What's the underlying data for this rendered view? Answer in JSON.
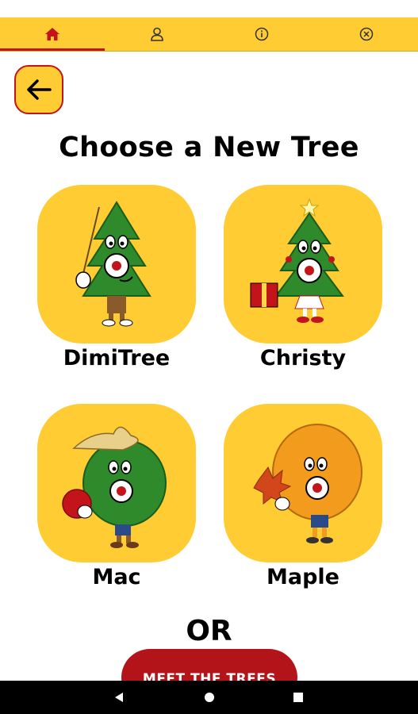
{
  "tabs": [
    {
      "icon": "home-icon",
      "active": true
    },
    {
      "icon": "person-icon",
      "active": false
    },
    {
      "icon": "info-icon",
      "active": false
    },
    {
      "icon": "close-circle-icon",
      "active": false
    }
  ],
  "back_button": {
    "icon": "arrow-left-icon"
  },
  "title": "Choose a New Tree",
  "trees": [
    {
      "name": "DimiTree"
    },
    {
      "name": "Christy"
    },
    {
      "name": "Mac"
    },
    {
      "name": "Maple"
    }
  ],
  "or_label": "OR",
  "meet_button_label": "MEET THE TREES",
  "colors": {
    "accent": "#FFCC33",
    "brand_red": "#C4141B"
  },
  "system_nav": [
    "back-icon",
    "home-icon",
    "recents-icon"
  ]
}
